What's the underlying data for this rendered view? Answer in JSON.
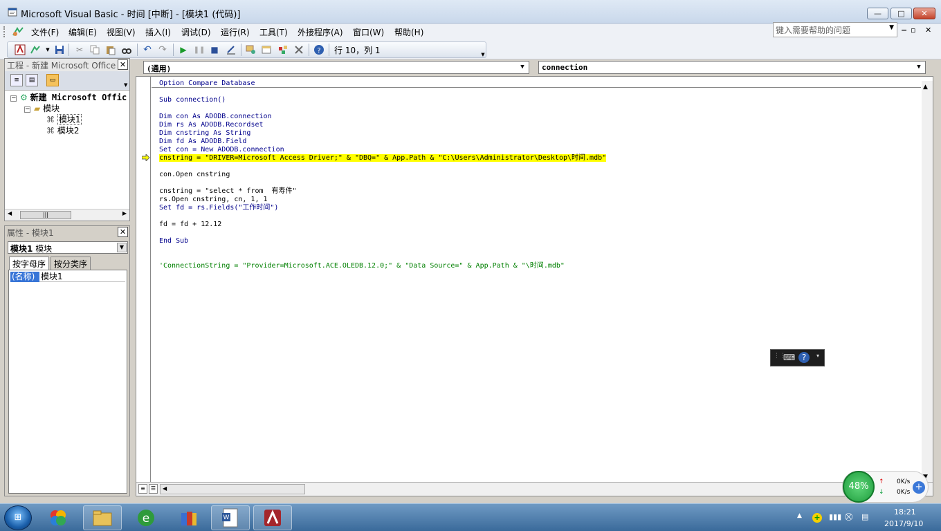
{
  "window": {
    "title": "Microsoft Visual Basic - 时间 [中断] - [模块1 (代码)]",
    "controls": {
      "minimize": "—",
      "maximize": "□",
      "close": "✕"
    }
  },
  "menu": {
    "items": [
      "文件(F)",
      "编辑(E)",
      "视图(V)",
      "插入(I)",
      "调试(D)",
      "运行(R)",
      "工具(T)",
      "外接程序(A)",
      "窗口(W)",
      "帮助(H)"
    ],
    "help_placeholder": "键入需要帮助的问题",
    "mdi_controls": {
      "minimize": "−",
      "restore": "▫",
      "close": "✕"
    }
  },
  "toolbar": {
    "position_text": "行 10，列 1",
    "icons": [
      "access-icon",
      "insert-module-icon",
      "save-icon",
      "cut-icon",
      "copy-icon",
      "paste-icon",
      "find-icon",
      "undo-icon",
      "redo-icon",
      "run-icon",
      "break-icon",
      "reset-icon",
      "design-mode-icon",
      "project-explorer-icon",
      "properties-icon",
      "object-browser-icon",
      "toolbox-icon",
      "help-icon"
    ]
  },
  "project_pane": {
    "title": "工程 - 新建 Microsoft Office Ac",
    "tree": {
      "root": "新建 Microsoft Offic",
      "folder": "模块",
      "items": [
        "模块1",
        "模块2"
      ]
    }
  },
  "properties_pane": {
    "title": "属性 - 模块1",
    "selected_object_bold": "模块1",
    "selected_object_type": "模块",
    "tabs": [
      "按字母序",
      "按分类序"
    ],
    "rows": [
      {
        "key": "(名称)",
        "value": "模块1"
      }
    ]
  },
  "code_window": {
    "object_combo": "(通用)",
    "procedure_combo": "connection",
    "current_line": 10,
    "lines": [
      "Option Compare Database",
      "",
      "Sub connection()",
      "",
      "Dim con As ADODB.connection",
      "Dim rs As ADODB.Recordset",
      "Dim cnstring As String",
      "Dim fd As ADODB.Field",
      "Set con = New ADODB.connection",
      "cnstring = \"DRIVER=Microsoft Access Driver;\" & \"DBQ=\" & App.Path & \"C:\\Users\\Administrator\\Desktop\\时间.mdb\"",
      "",
      "con.Open cnstring",
      "",
      "cnstring = \"select * from  有寿件\"",
      "rs.Open cnstring, cn, 1, 1",
      "Set fd = rs.Fields(\"工作时间\")",
      "",
      "fd = fd + 12.12",
      "",
      "End Sub",
      "",
      "",
      "'ConnectionString = \"Provider=Microsoft.ACE.OLEDB.12.0;\" & \"Data Source=\" & App.Path & \"\\时间.mdb\""
    ]
  },
  "speed_widget": {
    "percent": "48%",
    "upload": "0K/s",
    "download": "0K/s",
    "up_arrow": "↑",
    "down_arrow": "↓",
    "plus": "+"
  },
  "taskbar": {
    "apps": [
      "windows-logo-icon",
      "folder-icon",
      "ie-icon",
      "archive-icon",
      "word-icon",
      "access-icon"
    ],
    "clock_time": "18:21",
    "clock_date": "2017/9/10"
  },
  "colors": {
    "highlight": "#ffff00",
    "keyword": "#00008b",
    "comment": "#008000",
    "selection": "#3875d7"
  }
}
